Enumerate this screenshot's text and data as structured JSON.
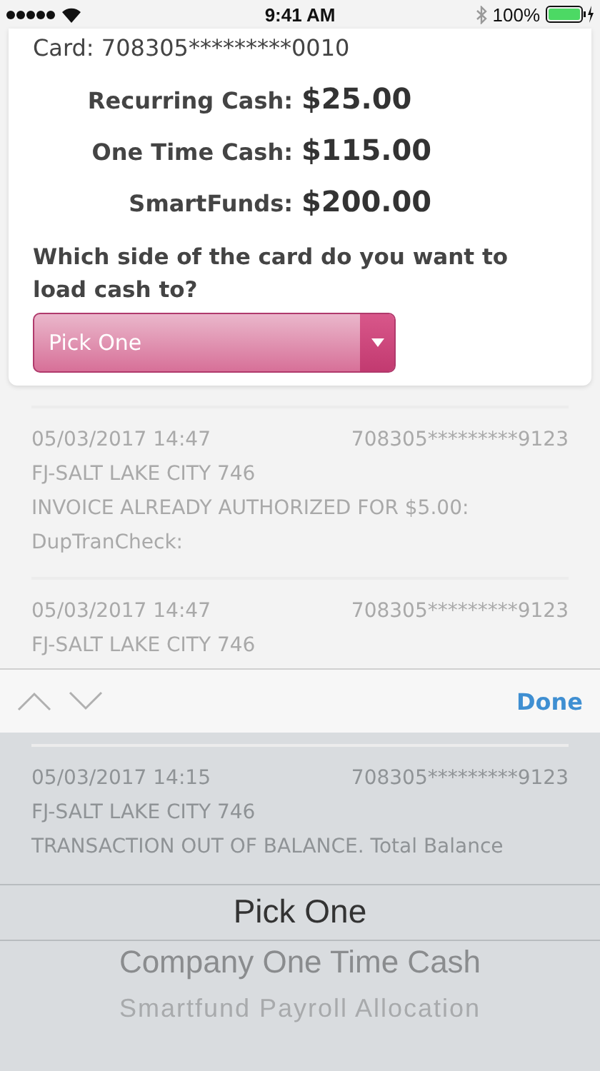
{
  "status_bar": {
    "time": "9:41 AM",
    "battery": "100%"
  },
  "transactions": [
    {
      "date": "05/03/2017 14:47",
      "card": "708305*********9123",
      "merchant": "FJ-SALT LAKE CITY 746",
      "message": "INVOICE ALREADY AUTHORIZED FOR $5.00:",
      "code": "DupTranCheck:"
    },
    {
      "date": "05/03/2017 14:47",
      "card": "708305*********9123",
      "merchant": "FJ-SALT LAKE CITY 746"
    }
  ],
  "dialog": {
    "card": "Card: 708305*********0010",
    "balances": [
      {
        "label": "Recurring Cash:",
        "amount": "$25.00"
      },
      {
        "label": "One Time Cash:",
        "amount": "$115.00"
      },
      {
        "label": "SmartFunds:",
        "amount": "$200.00"
      }
    ],
    "question": "Which side of the card do you want to load cash to?",
    "select": {
      "value": "Pick One"
    }
  },
  "picker": {
    "arrows_disabled": true,
    "done": "Done",
    "behind": {
      "date": "05/03/2017 14:15",
      "card": "708305*********9123",
      "merchant": "FJ-SALT LAKE CITY 746",
      "message": "TRANSACTION OUT OF BALANCE. Total Balance"
    },
    "options": [
      {
        "label": "Pick One",
        "selected": true
      },
      {
        "label": "Company One Time Cash",
        "selected": false
      },
      {
        "label": "Smartfund Payroll Allocation",
        "selected": false
      }
    ]
  }
}
